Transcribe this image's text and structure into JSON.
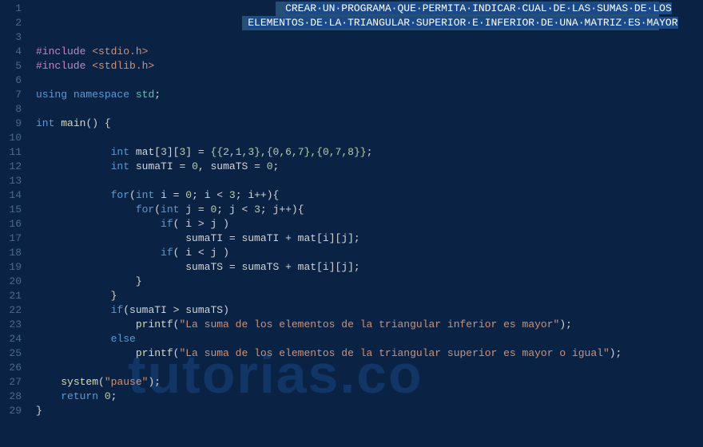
{
  "watermark": "tutorias.co",
  "gutter": {
    "start": 1,
    "end": 29
  },
  "code": {
    "l1_sel": "CREAR·UN·PROGRAMA·QUE·PERMITA·INDICAR·CUAL·DE·LAS·SUMAS·DE·LOS",
    "l2_sel": "ELEMENTOS·DE·LA·TRIANGULAR·SUPERIOR·E·INFERIOR·DE·UNA·MATRIZ·ES·MAYOR",
    "l4_pre": "#include ",
    "l4_inc": "<stdio.h>",
    "l5_pre": "#include ",
    "l5_inc": "<stdlib.h>",
    "l7_k1": "using",
    "l7_k2": "namespace",
    "l7_id": "std",
    "l9_k1": "int",
    "l9_fn": "main",
    "l11_k": "int",
    "l11_id": "mat",
    "l11_a": "3",
    "l11_b": "3",
    "l11_vals": "{{2,1,3},{0,6,7},{0,7,8}}",
    "l12_k": "int",
    "l12_i1": "sumaTI",
    "l12_v1": "0",
    "l12_i2": "sumaTS",
    "l12_v2": "0",
    "l14_k": "for",
    "l14_kin": "int",
    "l14_i": "i",
    "l14_v0": "0",
    "l14_cmp": "3",
    "l15_k": "for",
    "l15_kin": "int",
    "l15_i": "j",
    "l15_v0": "0",
    "l15_cmp": "3",
    "l16_k": "if",
    "l16_a": "i",
    "l16_b": "j",
    "l17_a": "sumaTI",
    "l17_b": "sumaTI",
    "l17_m": "mat",
    "l17_i": "i",
    "l17_j": "j",
    "l18_k": "if",
    "l18_a": "i",
    "l18_b": "j",
    "l19_a": "sumaTS",
    "l19_b": "sumaTS",
    "l19_m": "mat",
    "l19_i": "i",
    "l19_j": "j",
    "l22_k": "if",
    "l22_a": "sumaTI",
    "l22_b": "sumaTS",
    "l23_fn": "printf",
    "l23_s": "\"La suma de los elementos de la triangular inferior es mayor\"",
    "l24_k": "else",
    "l25_fn": "printf",
    "l25_s": "\"La suma de los elementos de la triangular superior es mayor o igual\"",
    "l27_fn": "system",
    "l27_s": "\"pause\"",
    "l28_k": "return",
    "l28_v": "0"
  }
}
